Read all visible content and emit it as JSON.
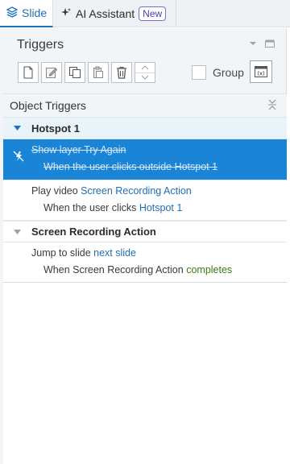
{
  "tabs": {
    "slide": {
      "label": "Slide",
      "icon": "layers-icon"
    },
    "ai": {
      "label": "AI Assistant",
      "badge": "New",
      "icon": "sparkle-icon"
    }
  },
  "triggers_panel": {
    "title": "Triggers",
    "group_label": "Group"
  },
  "object_triggers": {
    "header": "Object Triggers",
    "sections": [
      {
        "name": "Hotspot 1",
        "triggers": [
          {
            "selected": true,
            "disabled": true,
            "line1": "Show layer Try Again",
            "line2": "When the user clicks outside Hotspot 1"
          },
          {
            "selected": false,
            "line1_action": "Play video",
            "line1_target": "Screen Recording Action",
            "line2_prefix": "When the",
            "line2_mid": "user clicks",
            "line2_target": "Hotspot 1"
          }
        ]
      },
      {
        "name": "Screen Recording Action",
        "triggers": [
          {
            "selected": false,
            "line1_action": "Jump to slide",
            "line1_target": "next slide",
            "line2_prefix": "When Screen Recording Action",
            "line2_event": "completes"
          }
        ]
      }
    ]
  },
  "colors": {
    "accent": "#1e6fbf",
    "selected_row": "#1a84d6",
    "link": "#1f6fb5",
    "event_green": "#3f7a12"
  }
}
